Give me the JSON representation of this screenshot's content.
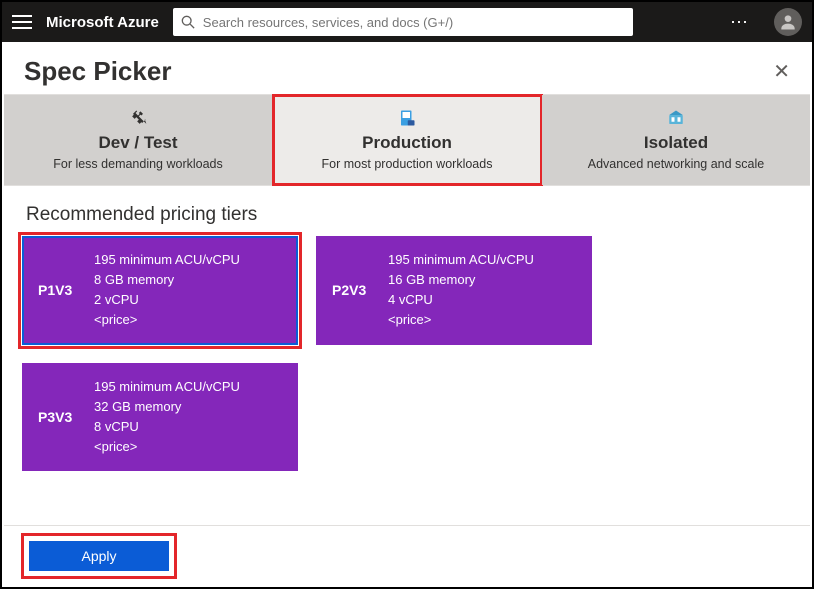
{
  "header": {
    "brand": "Microsoft Azure",
    "search_placeholder": "Search resources, services, and docs (G+/)",
    "more_label": "⋯"
  },
  "blade": {
    "title": "Spec Picker"
  },
  "tabs": [
    {
      "label": "Dev / Test",
      "desc": "For less demanding workloads",
      "active": false,
      "highlight": false
    },
    {
      "label": "Production",
      "desc": "For most production workloads",
      "active": true,
      "highlight": true
    },
    {
      "label": "Isolated",
      "desc": "Advanced networking and scale",
      "active": false,
      "highlight": false
    }
  ],
  "section_title": "Recommended pricing tiers",
  "tiers": [
    {
      "sku": "P1V3",
      "acu": "195 minimum ACU/vCPU",
      "memory": "8 GB memory",
      "vcpu": "2 vCPU",
      "price": "<price>",
      "selected": true
    },
    {
      "sku": "P2V3",
      "acu": "195 minimum ACU/vCPU",
      "memory": "16 GB memory",
      "vcpu": "4 vCPU",
      "price": "<price>",
      "selected": false
    },
    {
      "sku": "P3V3",
      "acu": "195 minimum ACU/vCPU",
      "memory": "32 GB memory",
      "vcpu": "8 vCPU",
      "price": "<price>",
      "selected": false
    }
  ],
  "footer": {
    "apply_label": "Apply"
  }
}
